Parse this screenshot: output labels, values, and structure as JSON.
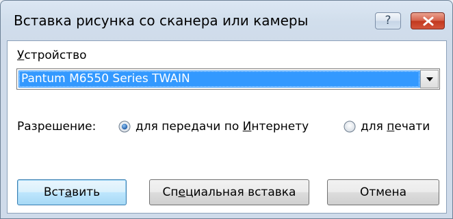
{
  "window": {
    "title": "Вставка рисунка со сканера или камеры",
    "help_label": "?"
  },
  "device": {
    "label_mnemonic": "У",
    "label_rest": "стройство",
    "selected": "Pantum M6550 Series TWAIN"
  },
  "resolution": {
    "label": "Разрешение:",
    "options": [
      {
        "before": "для передачи по ",
        "mnemonic": "И",
        "after": "нтернету",
        "checked": true
      },
      {
        "before": "для ",
        "mnemonic": "п",
        "after": "ечати",
        "checked": false
      }
    ]
  },
  "buttons": {
    "insert_before": "Вст",
    "insert_mnemonic": "а",
    "insert_after": "вить",
    "special_before": "Сп",
    "special_mnemonic": "е",
    "special_after": "циальная вставка",
    "cancel": "Отмена"
  },
  "colors": {
    "selection": "#3399ff",
    "radio_checked": "#1d5aa6",
    "close_button": "#c2391f"
  }
}
